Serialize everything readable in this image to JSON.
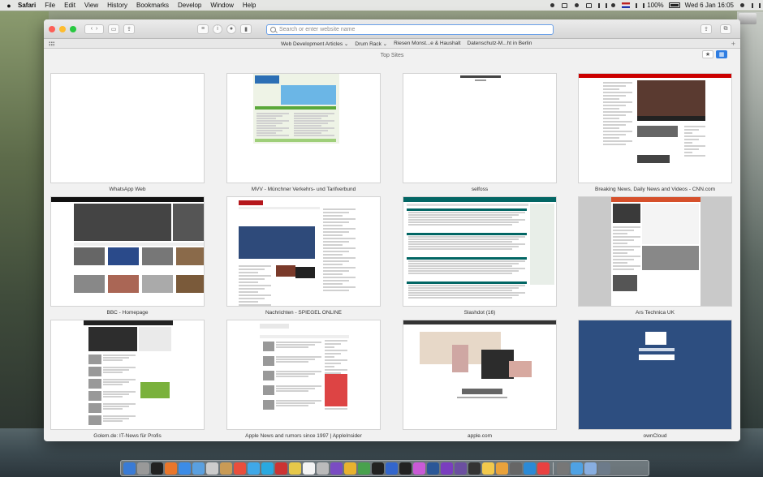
{
  "menubar": {
    "app_name": "Safari",
    "items": [
      "File",
      "Edit",
      "View",
      "History",
      "Bookmarks",
      "Develop",
      "Window",
      "Help"
    ],
    "battery": "100%",
    "clock": "Wed 6 Jan  16:05"
  },
  "toolbar": {
    "address_placeholder": "Search or enter website name"
  },
  "favorites": [
    "Web Development Articles ⌄",
    "Drum Rack ⌄",
    "Riesen Monst...e & Haushalt",
    "Datenschutz-M...ht in Berlin"
  ],
  "top_sites": {
    "title": "Top Sites",
    "tiles": [
      {
        "caption": "WhatsApp Web",
        "accent": "#f5f5f5"
      },
      {
        "caption": "MVV - Münchner Verkehrs- und Tarifverbund",
        "accent": "#5aa83a"
      },
      {
        "caption": "selfoss",
        "accent": "#ffffff"
      },
      {
        "caption": "Breaking News, Daily News and Videos - CNN.com",
        "accent": "#cc0000"
      },
      {
        "caption": "BBC - Homepage",
        "accent": "#1a1a1a"
      },
      {
        "caption": "Nachrichten - SPIEGEL ONLINE",
        "accent": "#b5171c"
      },
      {
        "caption": "Slashdot (16)",
        "accent": "#026664"
      },
      {
        "caption": "Ars Technica UK",
        "accent": "#d6502b"
      },
      {
        "caption": "Golem.de: IT-News für Profis",
        "accent": "#3d6e9c"
      },
      {
        "caption": "Apple News and rumors since 1997 | AppleInsider",
        "accent": "#3b7ccb"
      },
      {
        "caption": "apple.com",
        "accent": "#333333"
      },
      {
        "caption": "ownCloud",
        "accent": "#2d4e80"
      }
    ]
  },
  "icons": {
    "back": "‹",
    "forward": "›",
    "sidebar": "▭",
    "reader": "≡",
    "info": "i",
    "share": "⇪",
    "tabs": "⧉",
    "add": "+",
    "star": "★",
    "grid": "▦"
  },
  "dock_colors": [
    "#3a7bd5",
    "#999",
    "#222",
    "#e9762b",
    "#3c8ce7",
    "#5aa0e0",
    "#cccccc",
    "#c99b56",
    "#e94e3c",
    "#3fa8e8",
    "#2aa9e0",
    "#cc3333",
    "#e6c84a",
    "#f4f4f4",
    "#bbbbbb",
    "#7a4cc2",
    "#e8b22f",
    "#48a14d",
    "#222",
    "#3366cc",
    "#222",
    "#c95ad6",
    "#2b5797",
    "#7a3ebf",
    "#6b4fa0",
    "#333",
    "#f2c94c",
    "#e9a23b",
    "#666",
    "#2b8ad6",
    "#e94141",
    "#777",
    "#4fa2e4",
    "#88aee0",
    "#6d7b8a"
  ]
}
